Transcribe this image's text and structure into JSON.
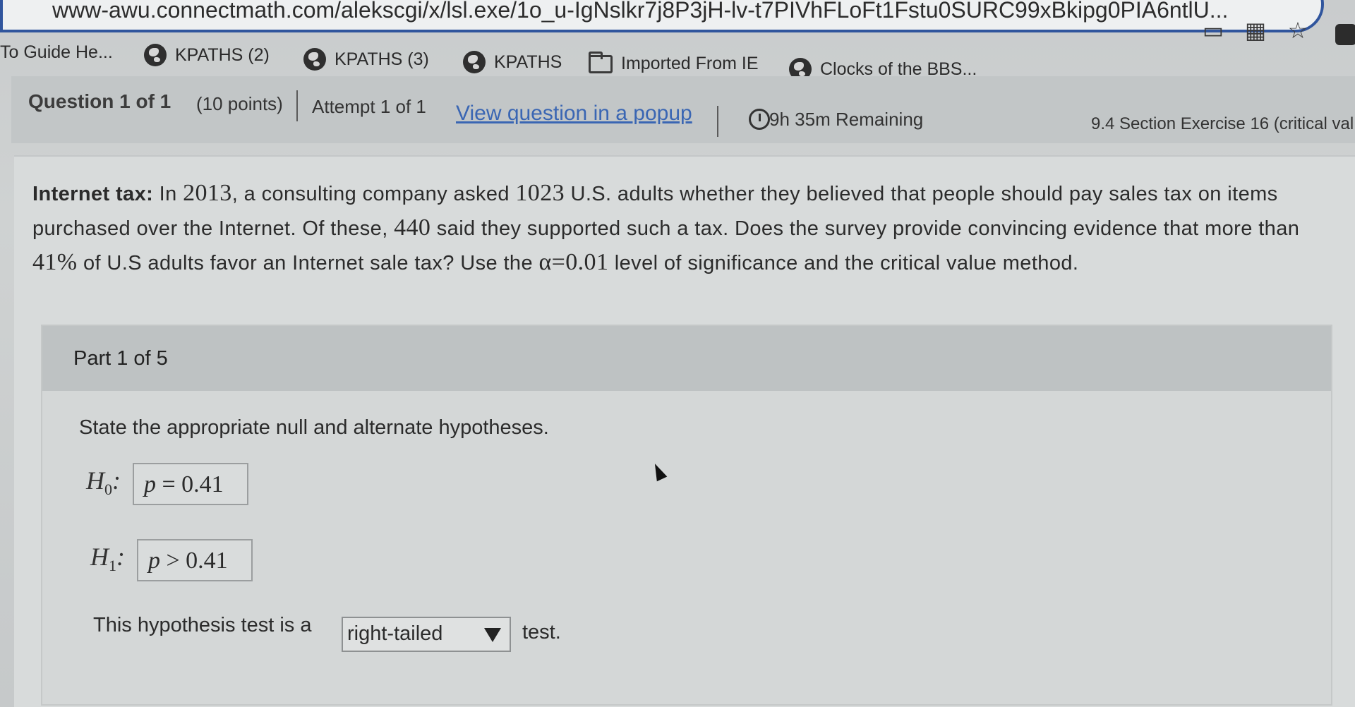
{
  "browser": {
    "url": "www-awu.connectmath.com/alekscgi/x/lsl.exe/1o_u-IgNslkr7j8P3jH-lv-t7PIVhFLoFt1Fstu0SURC99xBkipg0PIA6ntlU...",
    "icons": [
      "reader-mode-icon",
      "extensions-grid-icon",
      "star-icon",
      "extension-icon"
    ]
  },
  "bookmarks": [
    {
      "label": "To Guide He...",
      "icon": "none"
    },
    {
      "label": "KPATHS (2)",
      "icon": "globe-icon"
    },
    {
      "label": "KPATHS (3)",
      "icon": "globe-icon"
    },
    {
      "label": "KPATHS",
      "icon": "globe-icon"
    },
    {
      "label": "Imported From IE",
      "icon": "folder-icon"
    },
    {
      "label": "Clocks of the BBS...",
      "icon": "globe-icon"
    }
  ],
  "header": {
    "question": "Question 1 of 1",
    "points": "(10 points)",
    "attempt": "Attempt 1 of 1",
    "popup_link": "View question in a popup",
    "timer": "9h 35m Remaining",
    "exercise": "9.4 Section Exercise 16 (critical val"
  },
  "problem": {
    "title": "Internet tax:",
    "t1": " In ",
    "year": "2013",
    "t2": ", a consulting company asked ",
    "n": "1023",
    "t3": " U.S. adults whether they believed that people should pay sales tax on items purchased over the Internet. Of these, ",
    "x": "440",
    "t4": " said they supported such a tax. Does the survey provide convincing evidence that more than ",
    "pct": "41%",
    "t5": " of U.S adults favor an Internet sale tax? Use the ",
    "alpha": "α=0.01",
    "t6": " level of significance and the critical value method."
  },
  "part": {
    "label": "Part 1 of 5",
    "instruction": "State the appropriate null and alternate hypotheses.",
    "h0_label": "H",
    "h0_sub": "0",
    "h0_var": "p",
    "h0_rest": " = 0.41",
    "h1_label": "H",
    "h1_sub": "1",
    "h1_var": "p",
    "h1_rest": " > 0.41",
    "tail_prefix": "This hypothesis test is a",
    "tail_value": "right-tailed",
    "tail_suffix": "test."
  }
}
